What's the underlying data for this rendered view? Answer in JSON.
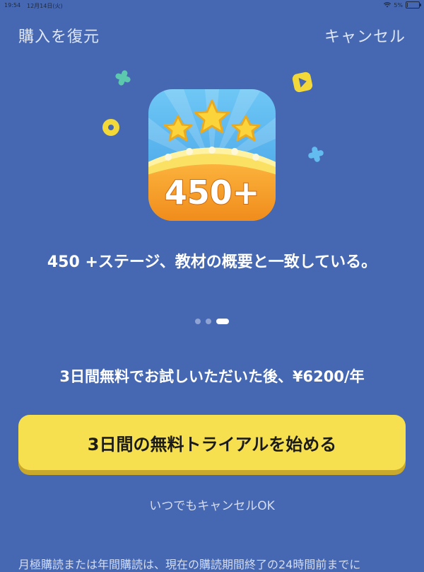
{
  "status_bar": {
    "time": "19:54",
    "date": "12月14日(火)",
    "battery": "5%",
    "battery_level": 0.05
  },
  "header": {
    "restore_label": "購入を復元",
    "cancel_label": "キャンセル"
  },
  "hero": {
    "badge_text": "450+",
    "headline": "450 +ステージ、教材の概要と一致している。"
  },
  "pager": {
    "count": 3,
    "active_index": 2
  },
  "offer": {
    "price_text": "3日間無料でお試しいただいた後、¥6200/年",
    "cta_label": "3日間の無料トライアルを始める",
    "cancel_note": "いつでもキャンセルOK",
    "legal_text": "月極購読または年間購読は、現在の購読期間終了の24時間前までに"
  },
  "colors": {
    "background": "#4668B2",
    "cta": "#F6E04F",
    "cta_shadow": "#C9A92C",
    "accent_mint": "#5CC8AE",
    "accent_yellow": "#F3D83A",
    "accent_blue": "#63BCF0"
  }
}
